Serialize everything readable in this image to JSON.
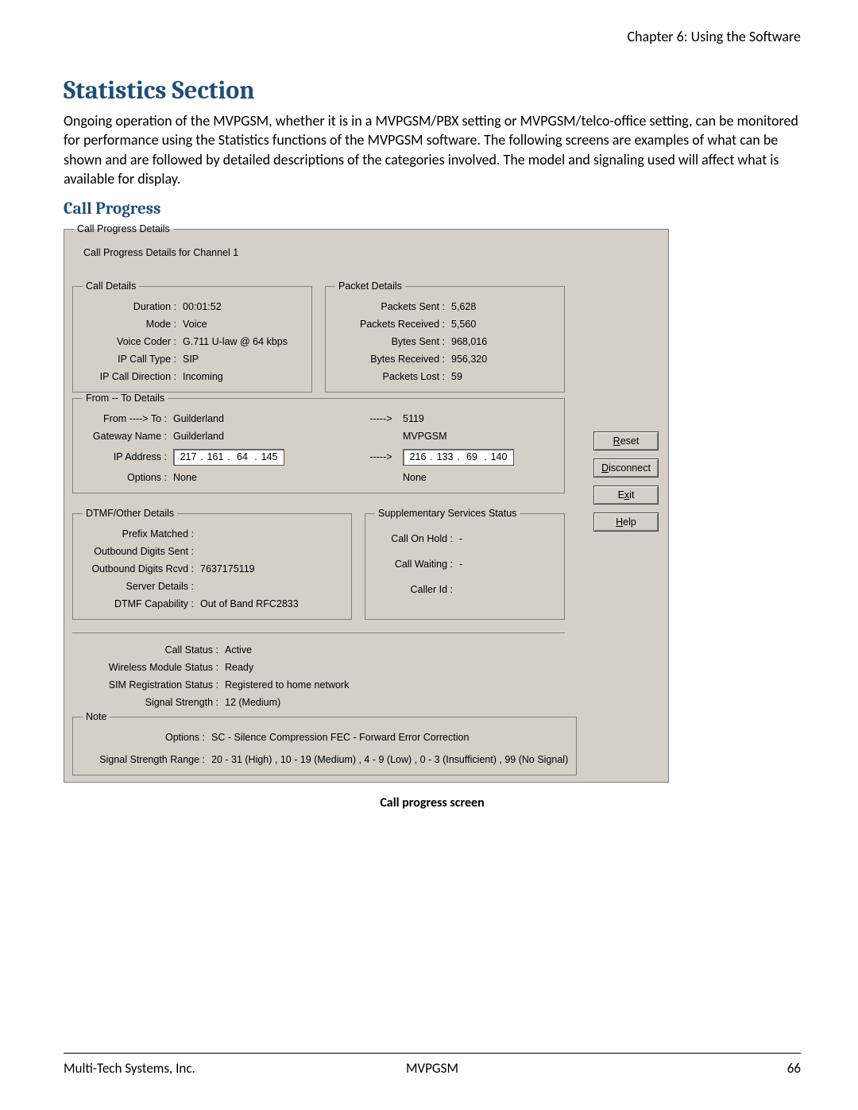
{
  "header": {
    "chapter": "Chapter 6: Using the Software"
  },
  "section": {
    "title": "Statistics Section",
    "paragraph": "Ongoing operation of the MVPGSM, whether it is in a MVPGSM/PBX setting or MVPGSM/telco-office setting, can be monitored for performance using the Statistics functions of the MVPGSM software. The following screens are examples of what can be shown and are followed by detailed descriptions of the categories involved. The model and signaling used will affect what is available for display.",
    "subsection": "Call Progress"
  },
  "dialog": {
    "outer_legend": "Call Progress Details",
    "caption_inside": "Call Progress Details for Channel 1",
    "call_details": {
      "legend": "Call Details",
      "rows": {
        "duration_label": "Duration :",
        "duration_value": "00:01:52",
        "mode_label": "Mode :",
        "mode_value": "Voice",
        "voice_coder_label": "Voice Coder :",
        "voice_coder_value": "G.711 U-law @ 64 kbps",
        "ip_call_type_label": "IP Call Type :",
        "ip_call_type_value": "SIP",
        "ip_call_dir_label": "IP Call Direction :",
        "ip_call_dir_value": "Incoming"
      }
    },
    "packet_details": {
      "legend": "Packet Details",
      "rows": {
        "packets_sent_label": "Packets Sent :",
        "packets_sent_value": "5,628",
        "packets_recv_label": "Packets Received :",
        "packets_recv_value": "5,560",
        "bytes_sent_label": "Bytes Sent :",
        "bytes_sent_value": "968,016",
        "bytes_recv_label": "Bytes Received :",
        "bytes_recv_value": "956,320",
        "packets_lost_label": "Packets Lost :",
        "packets_lost_value": "59"
      }
    },
    "from_to": {
      "legend": "From -- To Details",
      "from_to_label": "From ----> To :",
      "from_to_left": "Guilderland",
      "arrow": "----->",
      "from_to_right": "5119",
      "gw_label": "Gateway Name :",
      "gw_left": "Guilderland",
      "gw_right": "MVPGSM",
      "ip_label": "IP Address :",
      "ip_left": {
        "a": "217",
        "b": "161",
        "c": "64",
        "d": "145"
      },
      "ip_right": {
        "a": "216",
        "b": "133",
        "c": "69",
        "d": "140"
      },
      "options_label": "Options :",
      "options_left": "None",
      "options_right": "None"
    },
    "dtmf": {
      "legend": "DTMF/Other Details",
      "rows": {
        "prefix_label": "Prefix Matched :",
        "prefix_value": "",
        "out_sent_label": "Outbound Digits Sent :",
        "out_sent_value": "",
        "out_rcvd_label": "Outbound Digits Rcvd :",
        "out_rcvd_value": "7637175119",
        "server_label": "Server Details :",
        "server_value": "",
        "dtmf_cap_label": "DTMF Capability :",
        "dtmf_cap_value": "Out of Band RFC2833"
      }
    },
    "supp": {
      "legend": "Supplementary Services Status",
      "rows": {
        "hold_label": "Call On Hold :",
        "hold_value": "-",
        "wait_label": "Call Waiting :",
        "wait_value": "-",
        "cid_label": "Caller Id :",
        "cid_value": ""
      }
    },
    "status": {
      "call_status_label": "Call Status :",
      "call_status_value": "Active",
      "wireless_label": "Wireless Module Status :",
      "wireless_value": "Ready",
      "sim_label": "SIM Registration Status :",
      "sim_value": "Registered to home network",
      "signal_label": "Signal Strength :",
      "signal_value": "12 (Medium)"
    },
    "note": {
      "legend": "Note",
      "options_label": "Options :",
      "options_value": "SC - Silence Compression     FEC - Forward Error Correction",
      "signal_range_label": "Signal Strength Range :",
      "signal_range_value": "20 - 31 (High) , 10 - 19 (Medium) , 4 - 9 (Low) , 0 - 3 (Insufficient) , 99 (No Signal)"
    },
    "buttons": {
      "reset_pre": "",
      "reset_ul": "R",
      "reset_post": "eset",
      "disc_pre": "",
      "disc_ul": "D",
      "disc_post": "isconnect",
      "exit_pre": "E",
      "exit_ul": "x",
      "exit_post": "it",
      "help_pre": "",
      "help_ul": "H",
      "help_post": "elp"
    }
  },
  "caption": "Call progress screen",
  "footer": {
    "left": "Multi-Tech Systems, Inc.",
    "center": "MVPGSM",
    "right": "66"
  }
}
